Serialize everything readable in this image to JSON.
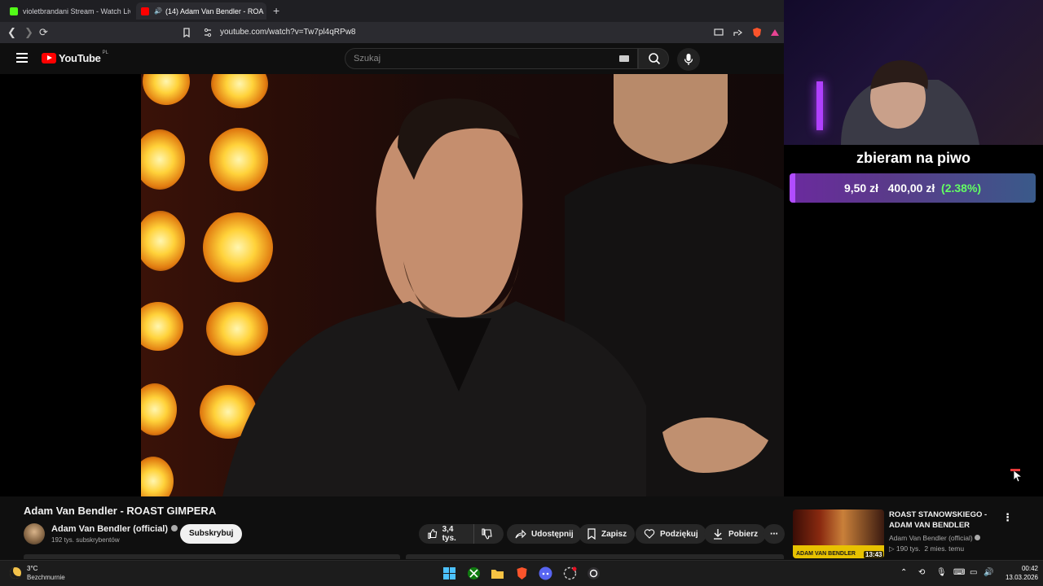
{
  "browser": {
    "tabs": [
      {
        "title": "violetbrandani Stream - Watch Live o",
        "active": false
      },
      {
        "title": "(14) Adam Van Bendler - ROA",
        "active": true
      }
    ],
    "url": "youtube.com/watch?v=Tw7pl4qRPw8"
  },
  "youtube": {
    "logo_text": "YouTube",
    "country_code": "PL",
    "search_placeholder": "Szukaj"
  },
  "overlay": {
    "goal_title": "zbieram na piwo",
    "goal_current": "9,50 zł",
    "goal_target": "400,00 zł",
    "goal_percent_text": "(2.38%)",
    "goal_fraction": 0.0238
  },
  "video": {
    "title": "Adam Van Bendler - ROAST GIMPERA",
    "channel": "Adam Van Bendler (official)",
    "subscribers": "192 tys. subskrybentów",
    "subscribe_label": "Subskrybuj",
    "likes": "3,4 tys.",
    "actions": {
      "share": "Udostępnij",
      "save": "Zapisz",
      "thanks": "Podziękuj",
      "download": "Pobierz"
    }
  },
  "recommendation": {
    "title_line1": "ROAST STANOWSKIEGO -",
    "title_line2": "ADAM VAN BENDLER",
    "channel": "Adam Van Bendler (official)",
    "views": "190 tys.",
    "age": "2 mies. temu",
    "duration": "13:43",
    "thumb_text": "ADAM VAN BENDLER"
  },
  "taskbar": {
    "temperature": "3°C",
    "condition": "Bezchmurnie",
    "time": "00:42",
    "date": "13.03.2026"
  },
  "colors": {
    "yt_red": "#ff0000",
    "goal_green": "#63ff63",
    "goal_purple": "#b14cff"
  }
}
